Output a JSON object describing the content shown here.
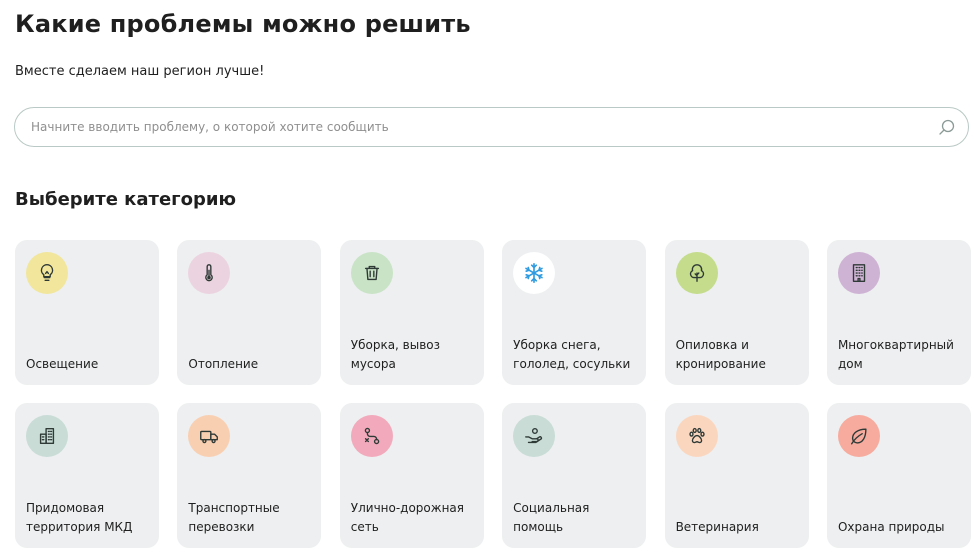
{
  "header": {
    "title": "Какие проблемы можно решить",
    "subtitle": "Вместе сделаем наш регион лучше!"
  },
  "search": {
    "placeholder": "Начните вводить проблему, о которой хотите сообщить",
    "icon": "search-icon"
  },
  "categories_section": {
    "title": "Выберите категорию",
    "items": [
      {
        "label": "Освещение",
        "icon": "lightbulb-icon",
        "color": "#f1e69c"
      },
      {
        "label": "Отопление",
        "icon": "thermometer-icon",
        "color": "#ecd3e0"
      },
      {
        "label": "Уборка, вывоз мусора",
        "icon": "trash-bin-icon",
        "color": "#c9e3c6"
      },
      {
        "label": "Уборка снега, гололед, сосульки",
        "icon": "snowflake-icon",
        "color": "#ffffff"
      },
      {
        "label": "Опиловка и кронирование",
        "icon": "tree-icon",
        "color": "#c4dc8b"
      },
      {
        "label": "Многоквартирный дом",
        "icon": "apartment-building-icon",
        "color": "#cfb3d5"
      },
      {
        "label": "Придомовая территория МКД",
        "icon": "buildings-icon",
        "color": "#c9dcd6"
      },
      {
        "label": "Транспортные перевозки",
        "icon": "truck-icon",
        "color": "#f9cfb2"
      },
      {
        "label": "Улично-дорожная сеть",
        "icon": "route-icon",
        "color": "#f2a9bb"
      },
      {
        "label": "Социальная помощь",
        "icon": "hand-help-icon",
        "color": "#c9dcd6"
      },
      {
        "label": "Ветеринария",
        "icon": "paw-icon",
        "color": "#fbd6bf"
      },
      {
        "label": "Охрана природы",
        "icon": "leaf-icon",
        "color": "#f6ab9e"
      }
    ]
  }
}
